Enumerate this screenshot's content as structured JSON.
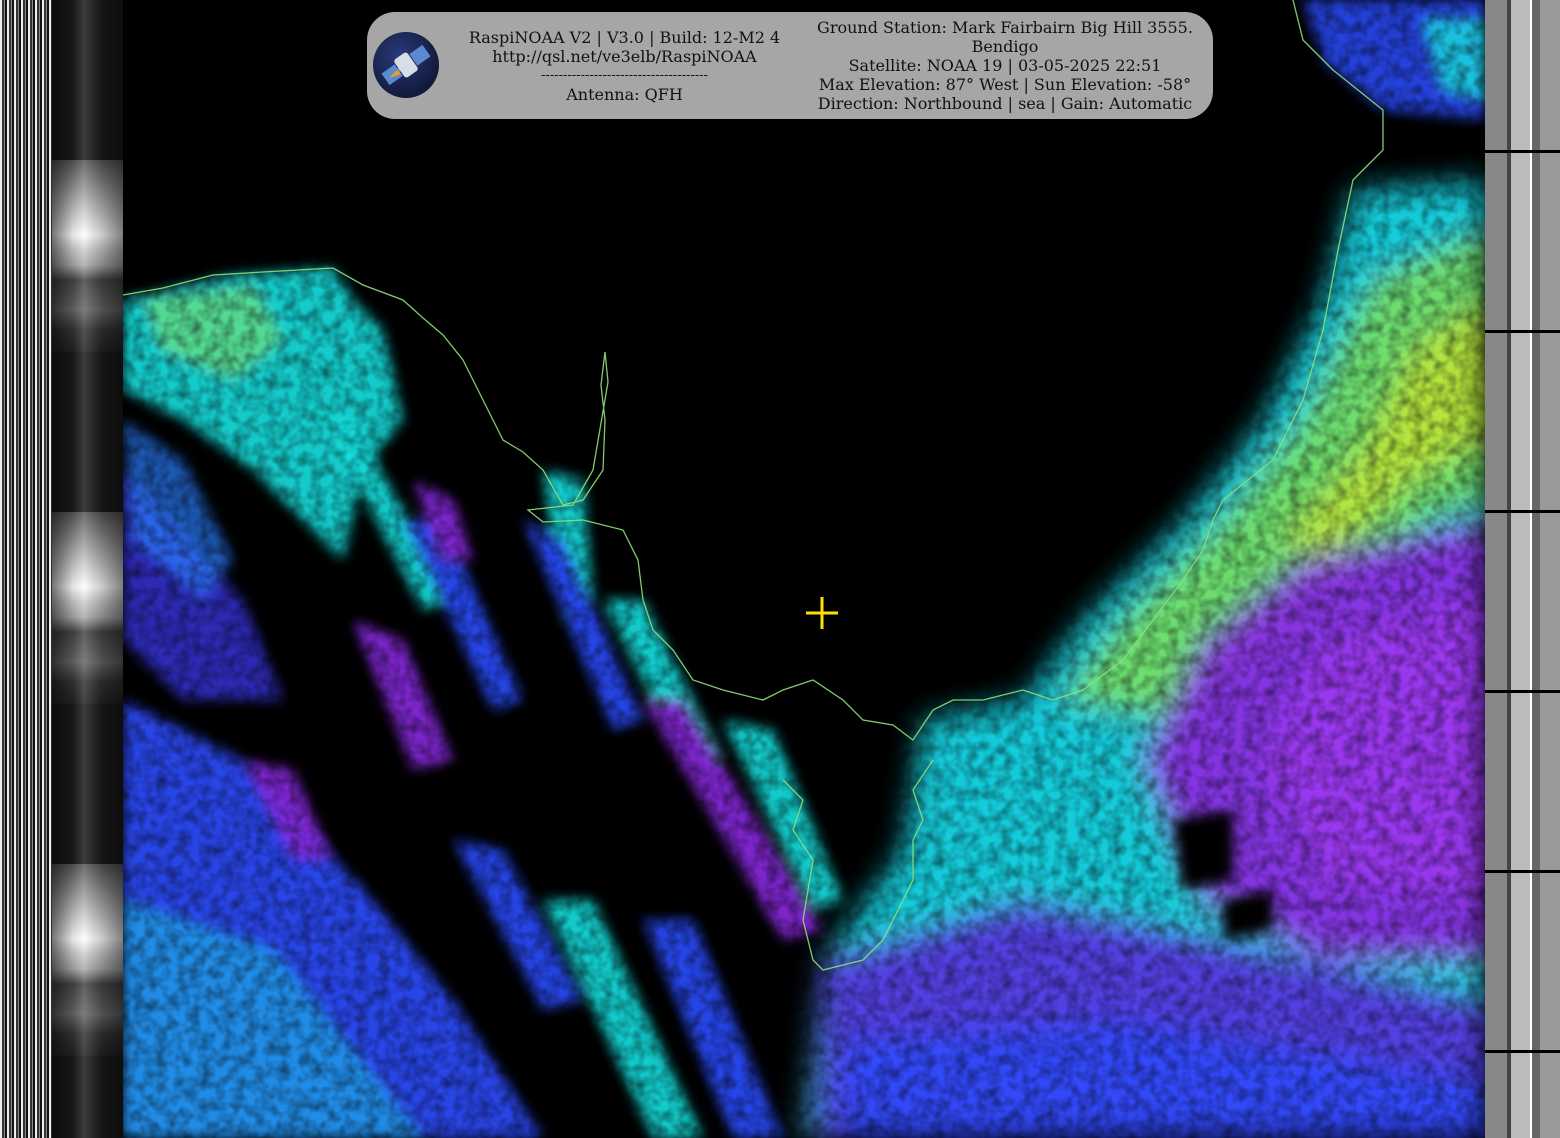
{
  "header": {
    "software_line": "RaspiNOAA V2 | V3.0 | Build: 12-M2 4",
    "url": "http://qsl.net/ve3elb/RaspiNOAA",
    "separator": "--------------------------------------",
    "antenna": "Antenna: QFH",
    "ground_station_line1": "Ground Station: Mark Fairbairn Big Hill 3555.",
    "ground_station_line2": "Bendigo",
    "satellite": "Satellite: NOAA 19 | 03-05-2025 22:51",
    "elevation": "Max Elevation: 87° West | Sun Elevation: -58°",
    "direction": "Direction: Northbound | sea | Gain: Automatic"
  },
  "icons": {
    "logo": "satellite-logo-icon",
    "marker": "crosshair-icon"
  },
  "colors": {
    "banner_bg": "#a6a6a6",
    "coastline": "#8fe07a",
    "marker": "#ffe000",
    "cloud_violet": "#8a2be2",
    "cloud_blue": "#2b4dff",
    "cloud_cyan": "#19e0e0",
    "cloud_green": "#7ce05a"
  }
}
